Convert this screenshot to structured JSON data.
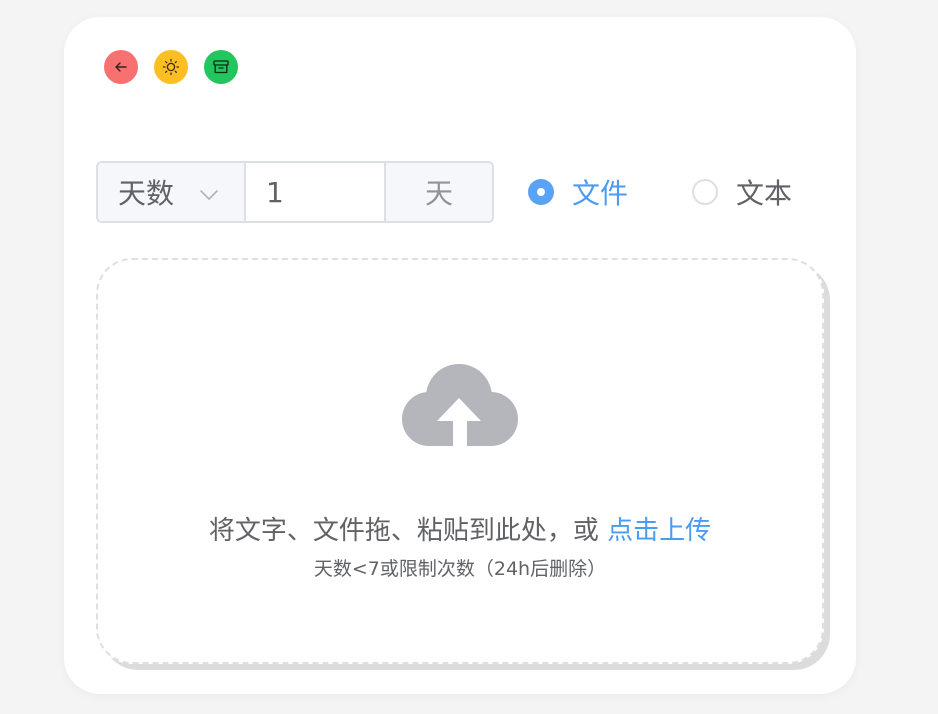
{
  "window_controls": {
    "back_icon": "arrow-left-icon",
    "theme_icon": "sun-icon",
    "archive_icon": "archive-box-icon",
    "colors": {
      "back": "#f87171",
      "theme": "#fbbf24",
      "archive": "#22c55e"
    }
  },
  "expiry": {
    "mode_selected": "天数",
    "mode_icon": "chevron-down-icon",
    "value": "1",
    "unit": "天"
  },
  "content_type": {
    "options": [
      {
        "label": "文件",
        "checked": true
      },
      {
        "label": "文本",
        "checked": false
      }
    ],
    "accent_color": "#5aa2f5"
  },
  "upload": {
    "icon": "cloud-upload-icon",
    "prompt": "将文字、文件拖、粘贴到此处，或",
    "link": "点击上传",
    "tip": "天数<7或限制次数（24h后删除）"
  }
}
